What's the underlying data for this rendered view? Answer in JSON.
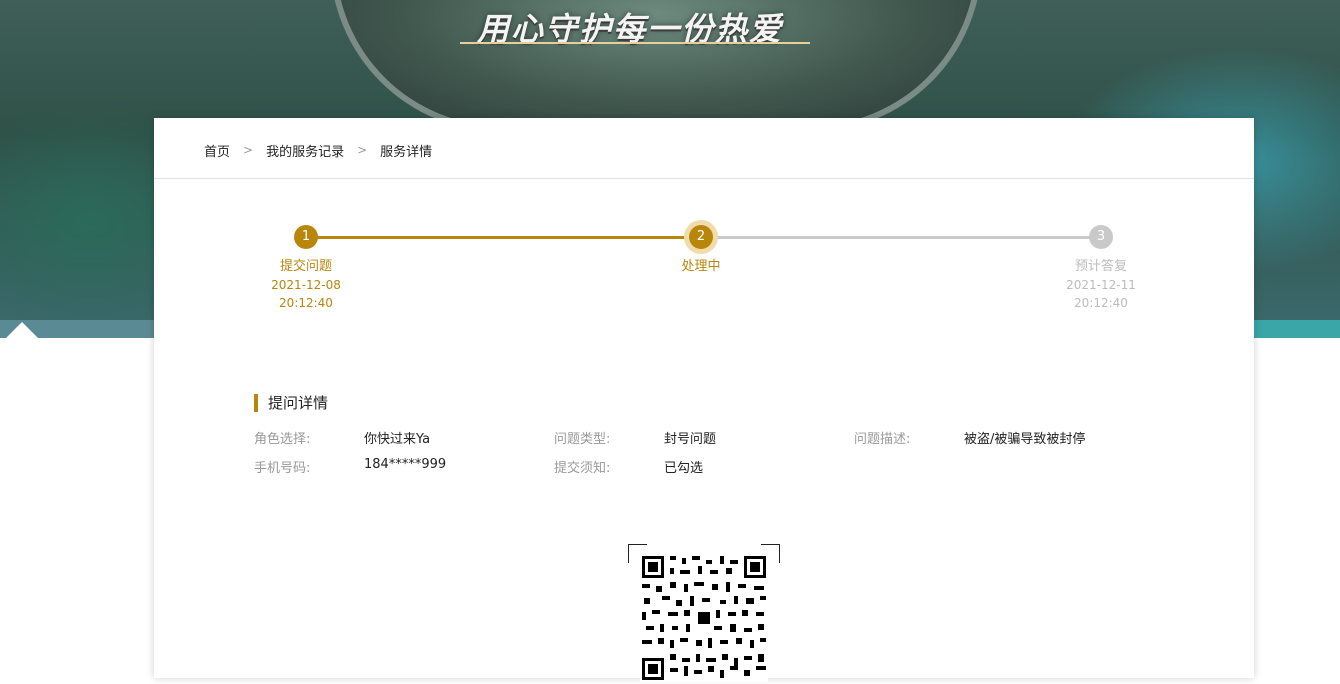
{
  "banner": {
    "slogan": "用心守护每一份热爱"
  },
  "breadcrumb": {
    "items": [
      "首页",
      "我的服务记录",
      "服务详情"
    ],
    "separator": ">"
  },
  "progress": {
    "steps": [
      {
        "number": "1",
        "title": "提交问题",
        "date": "2021-12-08",
        "time": "20:12:40",
        "state": "done"
      },
      {
        "number": "2",
        "title": "处理中",
        "date": "",
        "time": "",
        "state": "active"
      },
      {
        "number": "3",
        "title": "预计答复",
        "date": "2021-12-11",
        "time": "20:12:40",
        "state": "pending"
      }
    ]
  },
  "details": {
    "title": "提问详情",
    "fields": [
      {
        "label": "角色选择:",
        "value": "你快过来Ya"
      },
      {
        "label": "问题类型:",
        "value": "封号问题"
      },
      {
        "label": "问题描述:",
        "value": "被盗/被骗导致被封停"
      },
      {
        "label": "手机号码:",
        "value": "184*****999"
      },
      {
        "label": "提交须知:",
        "value": "已勾选"
      }
    ]
  },
  "colors": {
    "accent": "#b8860b",
    "pending": "#c9c9c9",
    "activeRing": "#f0dcaa"
  },
  "qr": {
    "icon": "qr-code-icon"
  }
}
